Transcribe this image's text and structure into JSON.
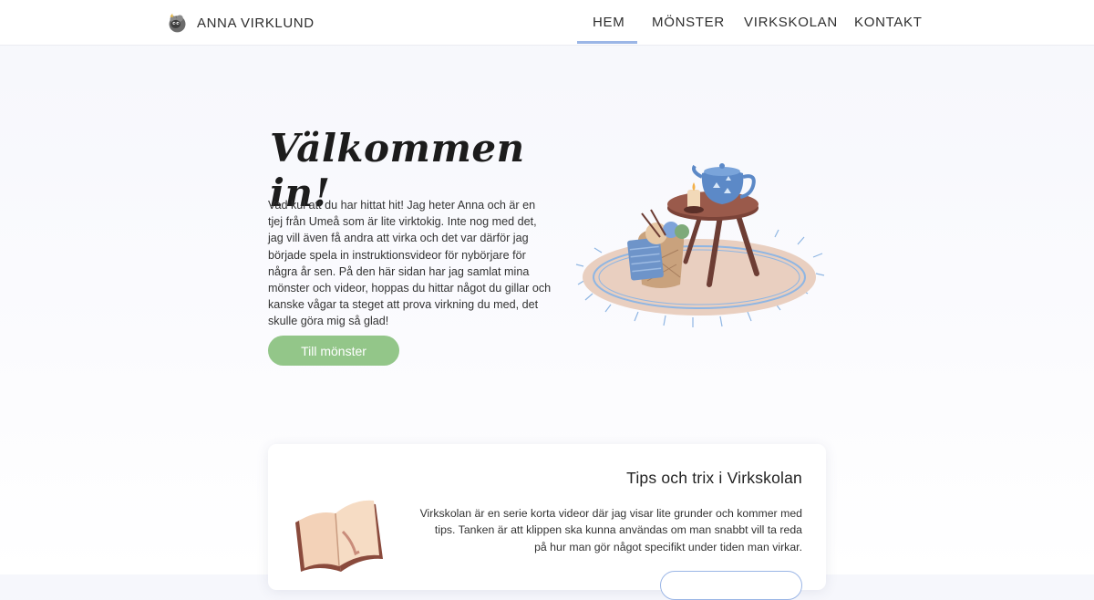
{
  "brand": {
    "name": "ANNA VIRKLUND",
    "logo_icon": "sheep-icon"
  },
  "nav": {
    "items": [
      {
        "label": "HEM",
        "active": true
      },
      {
        "label": "MÖNSTER",
        "active": false
      },
      {
        "label": "VIRKSKOLAN",
        "active": false
      },
      {
        "label": "KONTAKT",
        "active": false
      }
    ],
    "active_color": "#9bb6e6"
  },
  "hero": {
    "title": "Välkommen in!",
    "text": "Vad kul att du har hittat hit! Jag heter Anna och är en tjej från Umeå som är lite virktokig. Inte nog med det, jag vill även få andra att virka och det var därför jag började spela in instruktionsvideor för nybörjare för några år sen. På den här sidan har jag samlat mina mönster och videor, hoppas du hittar något du gillar och kanske vågar ta steget att prova virkning du med, det skulle göra mig så glad!",
    "button_label": "Till mönster",
    "button_color": "#93c689",
    "illustration_icon": "tea-table-yarn-basket-illustration"
  },
  "card": {
    "title": "Tips och trix i Virkskolan",
    "text": "Virkskolan är en serie korta videor där jag visar lite grunder och kommer med tips. Tanken är att klippen ska kunna användas om man snabbt vill ta reda på hur man gör något specifikt under tiden man virkar.",
    "illustration_icon": "open-book-icon"
  }
}
